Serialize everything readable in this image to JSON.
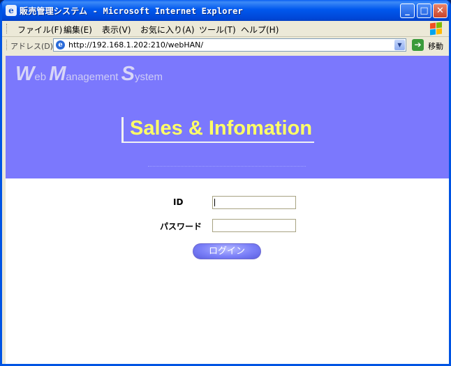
{
  "window": {
    "app_icon": "ie-icon",
    "title": "販売管理システム - Microsoft Internet Explorer",
    "buttons": {
      "minimize": "_",
      "maximize": "□",
      "close": "✕"
    }
  },
  "menu": {
    "items": [
      "ファイル(F)",
      "編集(E)",
      "表示(V)",
      "お気に入り(A)",
      "ツール(T)",
      "ヘルプ(H)"
    ]
  },
  "address": {
    "label": "アドレス(D)",
    "url": "http://192.168.1.202:210/webHAN/",
    "go_label": "移動"
  },
  "banner": {
    "logo_parts": [
      "W",
      "eb ",
      "M",
      "anagement ",
      "S",
      "ystem"
    ],
    "title": "Sales & Infomation",
    "background_color": "#7b78fd",
    "title_color": "#ffff66"
  },
  "login": {
    "id_label": "ID",
    "id_value": "",
    "password_label": "パスワード",
    "password_value": "",
    "submit_label": "ログイン"
  }
}
